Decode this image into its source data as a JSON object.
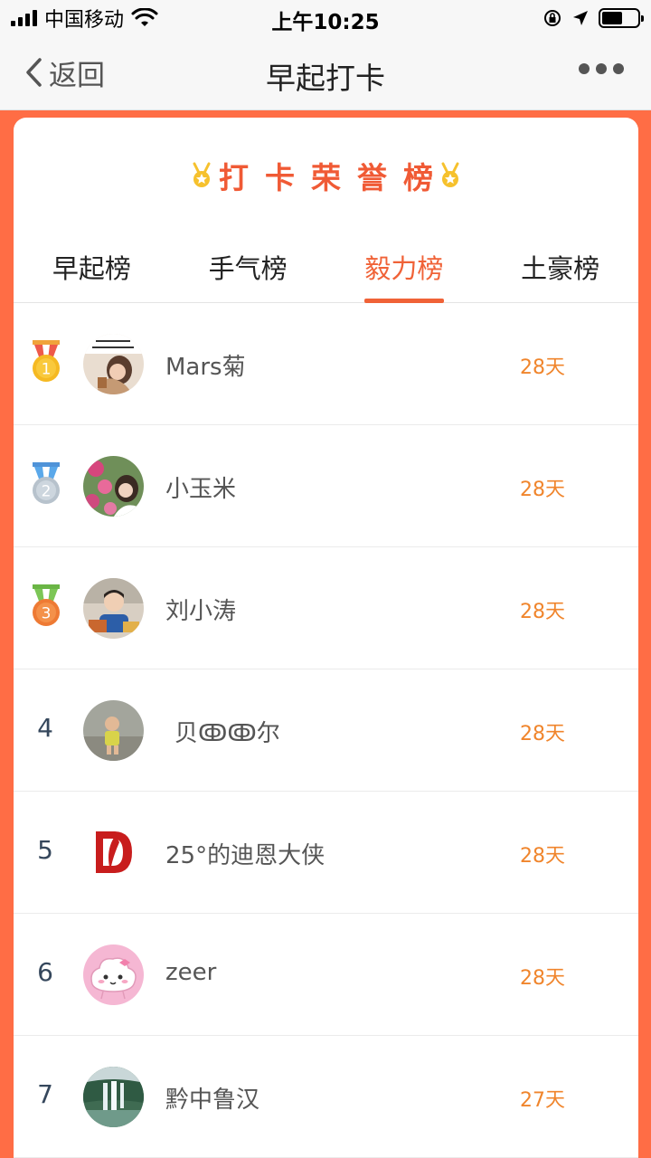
{
  "status_bar": {
    "carrier": "中国移动",
    "time": "上午10:25"
  },
  "nav": {
    "back_label": "返回",
    "title": "早起打卡"
  },
  "card": {
    "honor_title": "打卡荣誉榜"
  },
  "tabs": [
    {
      "label": "早起榜",
      "active": false
    },
    {
      "label": "手气榜",
      "active": false
    },
    {
      "label": "毅力榜",
      "active": true
    },
    {
      "label": "土豪榜",
      "active": false
    }
  ],
  "colors": {
    "accent": "#f06237",
    "days": "#f0852c",
    "background": "#ff6d45"
  },
  "ranking": [
    {
      "rank": "1",
      "medal": "gold-medal-icon",
      "name": "Mars菊",
      "days": "28天"
    },
    {
      "rank": "2",
      "medal": "silver-medal-icon",
      "name": "小玉米",
      "days": "28天"
    },
    {
      "rank": "3",
      "medal": "bronze-medal-icon",
      "name": "刘小涛",
      "days": "28天"
    },
    {
      "rank": "4",
      "name": "贝ↂↂ尔",
      "days": "28天"
    },
    {
      "rank": "5",
      "name": "25°的迪恩大侠",
      "days": "28天"
    },
    {
      "rank": "6",
      "name": "zeer",
      "days": "28天"
    },
    {
      "rank": "7",
      "name": "黔中鲁汉",
      "days": "27天"
    }
  ]
}
